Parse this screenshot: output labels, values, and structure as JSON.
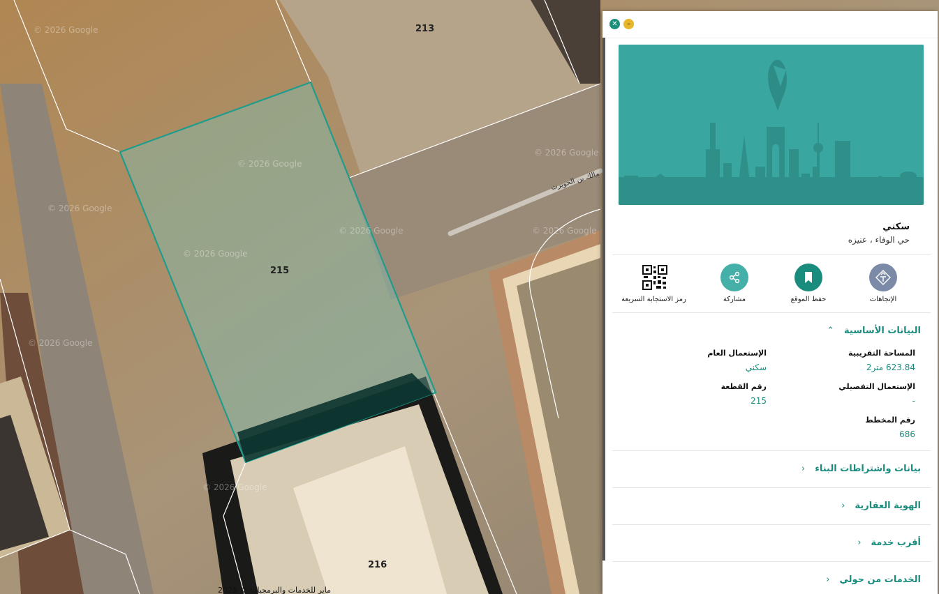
{
  "map": {
    "parcels": [
      "213",
      "215",
      "216"
    ],
    "street_name": "مالك بن الحويرث",
    "watermark": "© 2026 Google",
    "copyright": "2025 © ماير للخدمات والبرمجيات",
    "highlight_color": "#1f9c8c"
  },
  "panel": {
    "close_icon": "close-icon",
    "minimize_icon": "minimize-icon",
    "property_type": "سكني",
    "location": "حي الوفاء ، عنيزه",
    "actions": [
      {
        "label": "الإتجاهات",
        "icon": "directions-icon",
        "color": "#7b8aa6"
      },
      {
        "label": "حفظ الموقع",
        "icon": "bookmark-icon",
        "color": "#1a8c7e"
      },
      {
        "label": "مشاركة",
        "icon": "share-icon",
        "color": "#45b0a8"
      },
      {
        "label": "رمز الاستجابة السريعة",
        "icon": "qr-code-icon",
        "color": "#111111"
      }
    ],
    "basic_section": {
      "title": "البيانات الأساسية",
      "fields": {
        "approx_area_label": "المساحة التقريبية",
        "approx_area_value": "623.84 متر2",
        "general_use_label": "الإستعمال العام",
        "general_use_value": "سكني",
        "detailed_use_label": "الإستعمال التفصيلي",
        "detailed_use_value": "-",
        "plot_number_label": "رقم القطعة",
        "plot_number_value": "215",
        "plan_number_label": "رقم المخطط",
        "plan_number_value": "686"
      }
    },
    "sections": [
      "بيانات واشتراطات البناء",
      "الهوية العقارية",
      "أقرب خدمة",
      "الخدمات من حولي"
    ]
  }
}
